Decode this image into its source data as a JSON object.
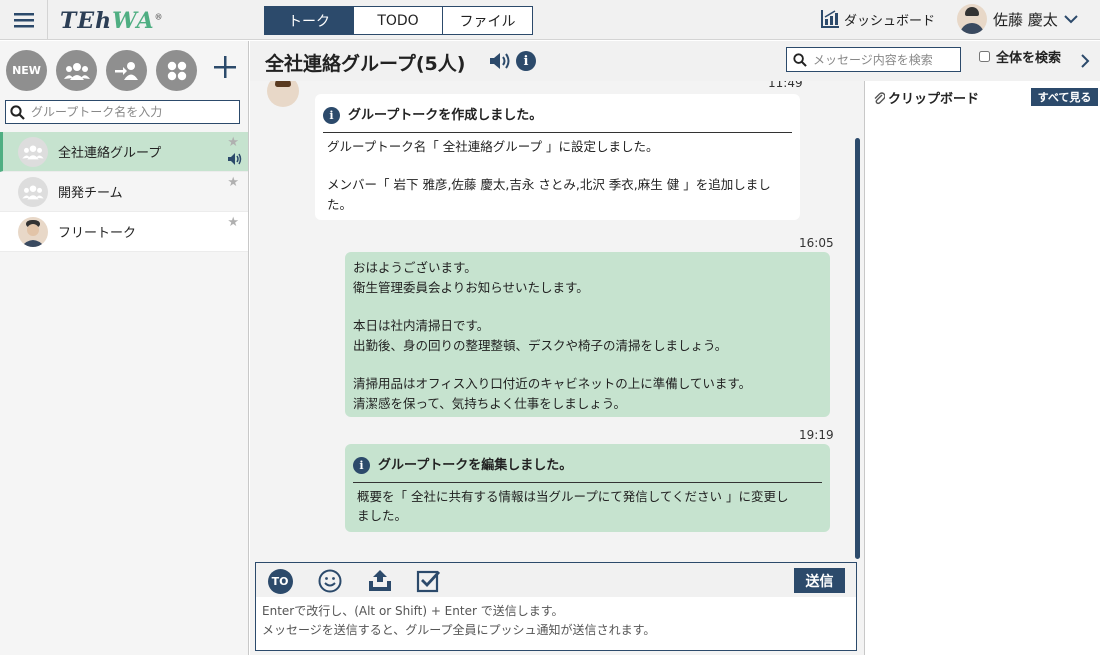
{
  "app": {
    "logo_main": "TEh",
    "logo_accent": "WA",
    "logo_mark": "®"
  },
  "topnav": {
    "tabs": [
      {
        "label": "トーク"
      },
      {
        "label": "TODO"
      },
      {
        "label": "ファイル"
      }
    ]
  },
  "header_right": {
    "dashboard_label": "ダッシュボード",
    "user_name": "佐藤 慶太"
  },
  "sidebar": {
    "new_label": "NEW",
    "search_placeholder": "グループトーク名を入力",
    "groups": [
      {
        "name": "全社連絡グループ",
        "active": true
      },
      {
        "name": "開発チーム"
      },
      {
        "name": "フリートーク"
      }
    ]
  },
  "main": {
    "group_title": "全社連絡グループ(5人)",
    "search_placeholder": "メッセージ内容を検索",
    "all_search_label": "全体を検索"
  },
  "messages": [
    {
      "time": "11:49",
      "title": "グループトークを作成しました。",
      "lines": [
        "グループトーク名「 全社連絡グループ 」に設定しました。",
        "",
        "メンバー「 岩下 雅彦,佐藤 慶太,吉永 さとみ,北沢 季衣,麻生 健 」を追加しまし",
        "た。"
      ]
    },
    {
      "time": "16:05",
      "lines": [
        "おはようございます。",
        "衛生管理委員会よりお知らせいたします。",
        "",
        "本日は社内清掃日です。",
        "出勤後、身の回りの整理整頓、デスクや椅子の清掃をしましょう。",
        "",
        "清掃用品はオフィス入り口付近のキャビネットの上に準備しています。",
        "清潔感を保って、気持ちよく仕事をしましょう。"
      ]
    },
    {
      "time": "19:19",
      "title": "グループトークを編集しました。",
      "lines": [
        "概要を「 全社に共有する情報は当グループにて発信してください 」に変更し",
        "ました。"
      ]
    }
  ],
  "clipboard": {
    "title": "クリップボード",
    "see_all": "すべて見る"
  },
  "compose": {
    "to_label": "TO",
    "send_label": "送信",
    "placeholder": "Enterで改行し、(Alt or Shift) + Enter で送信します。\nメッセージを送信すると、グループ全員にプッシュ通知が送信されます。"
  },
  "colors": {
    "navy": "#2c4a6b",
    "green_bubble": "#c6e3cf",
    "logo_green": "#4fae82"
  }
}
